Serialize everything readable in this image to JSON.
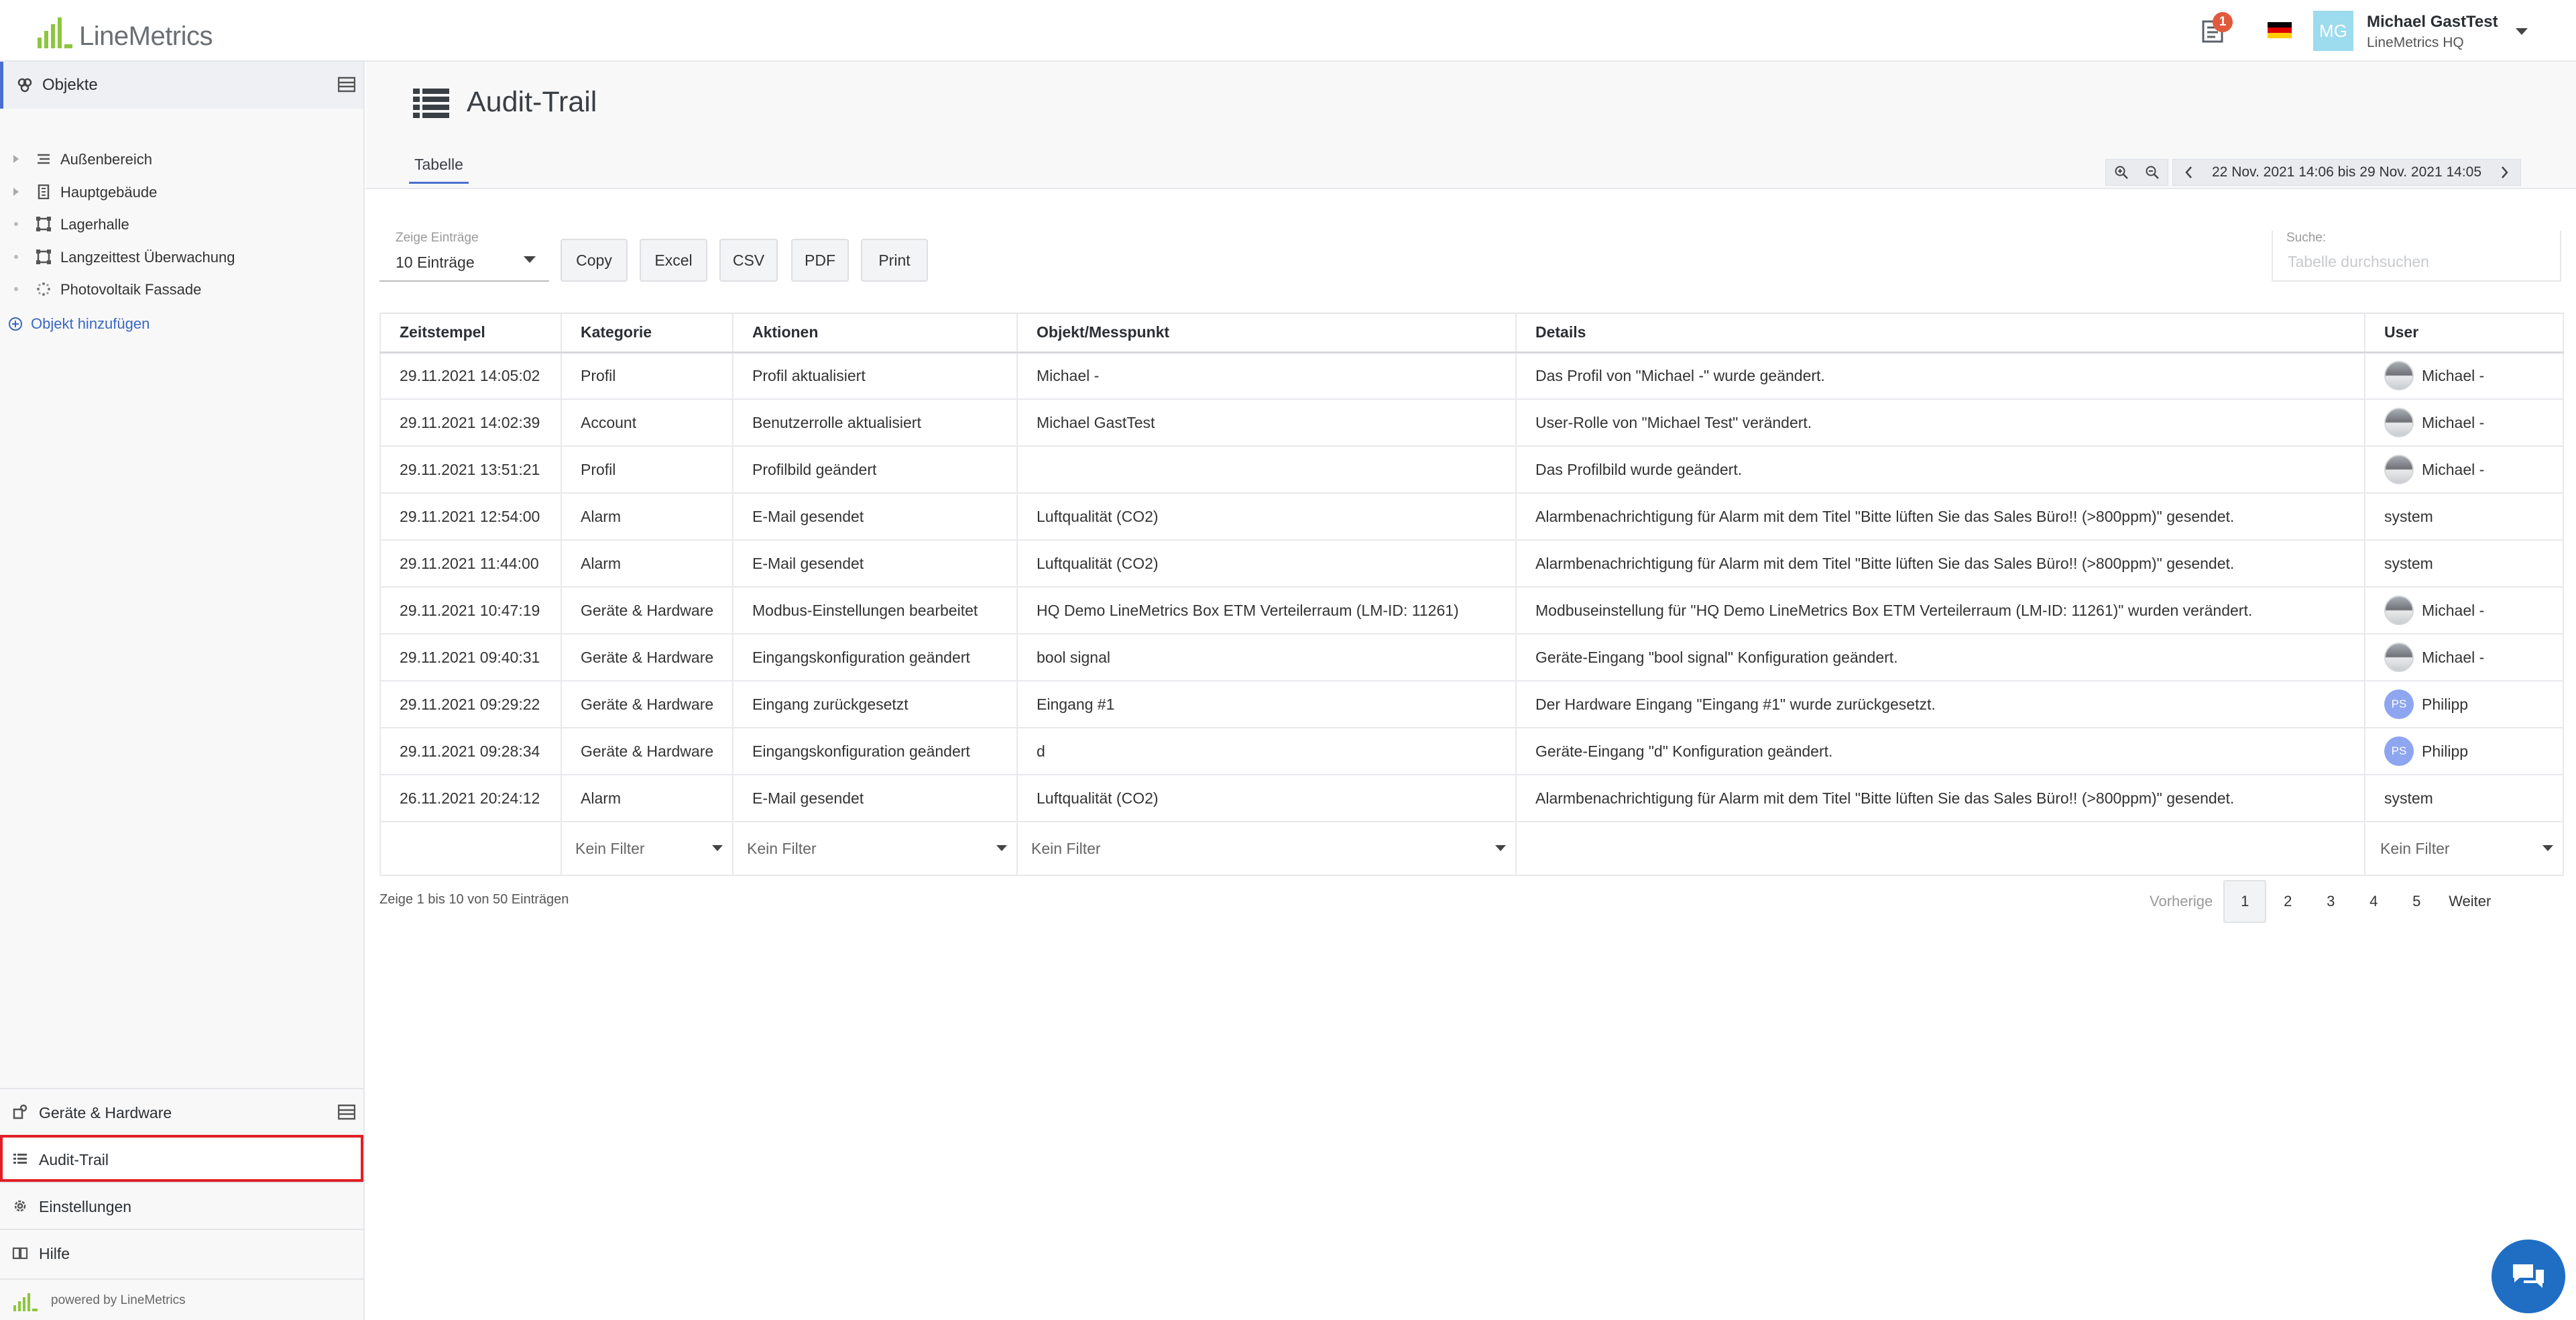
{
  "header": {
    "logo_text": "LineMetrics",
    "notification_count": "1",
    "avatar_initials": "MG",
    "user_name": "Michael GastTest",
    "user_org": "LineMetrics HQ"
  },
  "sidebar": {
    "objects_title": "Objekte",
    "tree": [
      {
        "label": "Außenbereich",
        "icon": "site-icon"
      },
      {
        "label": "Hauptgebäude",
        "icon": "building-icon"
      },
      {
        "label": "Lagerhalle",
        "icon": "area-icon"
      },
      {
        "label": "Langzeittest Überwachung",
        "icon": "area-icon"
      },
      {
        "label": "Photovoltaik Fassade",
        "icon": "loading-icon"
      }
    ],
    "add_object": "Objekt hinzufügen",
    "nav": {
      "devices": "Geräte & Hardware",
      "audit": "Audit-Trail",
      "settings": "Einstellungen",
      "help": "Hilfe"
    },
    "powered_by": "powered by LineMetrics"
  },
  "page": {
    "title": "Audit-Trail",
    "tab": "Tabelle",
    "date_range": "22 Nov. 2021 14:06 bis 29 Nov. 2021 14:05"
  },
  "toolbar": {
    "show_label": "Zeige Einträge",
    "show_value": "10 Einträge",
    "buttons": [
      "Copy",
      "Excel",
      "CSV",
      "PDF",
      "Print"
    ],
    "search_label": "Suche:",
    "search_placeholder": "Tabelle durchsuchen"
  },
  "table": {
    "columns": [
      "Zeitstempel",
      "Kategorie",
      "Aktionen",
      "Objekt/Messpunkt",
      "Details",
      "User"
    ],
    "rows": [
      {
        "ts": "29.11.2021 14:05:02",
        "cat": "Profil",
        "act": "Profil aktualisiert",
        "obj": "Michael -",
        "det": "Das Profil von \"Michael -\" wurde geändert.",
        "user": "Michael -",
        "avatar": "photo"
      },
      {
        "ts": "29.11.2021 14:02:39",
        "cat": "Account",
        "act": "Benutzerrolle aktualisiert",
        "obj": "Michael GastTest",
        "det": "User-Rolle von \"Michael Test\" verändert.",
        "user": "Michael -",
        "avatar": "photo"
      },
      {
        "ts": "29.11.2021 13:51:21",
        "cat": "Profil",
        "act": "Profilbild geändert",
        "obj": "",
        "det": "Das Profilbild wurde geändert.",
        "user": "Michael -",
        "avatar": "photo"
      },
      {
        "ts": "29.11.2021 12:54:00",
        "cat": "Alarm",
        "act": "E-Mail gesendet",
        "obj": "Luftqualität (CO2)",
        "det": "Alarmbenachrichtigung für Alarm mit dem Titel \"Bitte lüften Sie das Sales Büro!! (>800ppm)\" gesendet.",
        "user": "system",
        "avatar": ""
      },
      {
        "ts": "29.11.2021 11:44:00",
        "cat": "Alarm",
        "act": "E-Mail gesendet",
        "obj": "Luftqualität (CO2)",
        "det": "Alarmbenachrichtigung für Alarm mit dem Titel \"Bitte lüften Sie das Sales Büro!! (>800ppm)\" gesendet.",
        "user": "system",
        "avatar": ""
      },
      {
        "ts": "29.11.2021 10:47:19",
        "cat": "Geräte & Hardware",
        "act": "Modbus-Einstellungen bearbeitet",
        "obj": "HQ Demo LineMetrics Box ETM Verteilerraum (LM-ID: 11261)",
        "det": "Modbuseinstellung für \"HQ Demo LineMetrics Box ETM Verteilerraum (LM-ID: 11261)\" wurden verändert.",
        "user": "Michael -",
        "avatar": "photo"
      },
      {
        "ts": "29.11.2021 09:40:31",
        "cat": "Geräte & Hardware",
        "act": "Eingangskonfiguration geändert",
        "obj": "bool signal",
        "det": "Geräte-Eingang \"bool signal\" Konfiguration geändert.",
        "user": "Michael -",
        "avatar": "photo"
      },
      {
        "ts": "29.11.2021 09:29:22",
        "cat": "Geräte & Hardware",
        "act": "Eingang zurückgesetzt",
        "obj": "Eingang #1",
        "det": "Der Hardware Eingang \"Eingang #1\" wurde zurückgesetzt.",
        "user": "Philipp",
        "avatar": "PS"
      },
      {
        "ts": "29.11.2021 09:28:34",
        "cat": "Geräte & Hardware",
        "act": "Eingangskonfiguration geändert",
        "obj": "d",
        "det": "Geräte-Eingang \"d\" Konfiguration geändert.",
        "user": "Philipp",
        "avatar": "PS"
      },
      {
        "ts": "26.11.2021 20:24:12",
        "cat": "Alarm",
        "act": "E-Mail gesendet",
        "obj": "Luftqualität (CO2)",
        "det": "Alarmbenachrichtigung für Alarm mit dem Titel \"Bitte lüften Sie das Sales Büro!! (>800ppm)\" gesendet.",
        "user": "system",
        "avatar": ""
      }
    ],
    "filter_placeholder": "Kein Filter"
  },
  "footer": {
    "info": "Zeige 1 bis 10 von 50 Einträgen",
    "prev": "Vorherige",
    "pages": [
      "1",
      "2",
      "3",
      "4",
      "5"
    ],
    "next": "Weiter"
  },
  "colors": {
    "accent": "#4a6fd0",
    "logo_green": "#8cc63f",
    "highlight": "#e21f26",
    "chat": "#1f6ec4"
  }
}
